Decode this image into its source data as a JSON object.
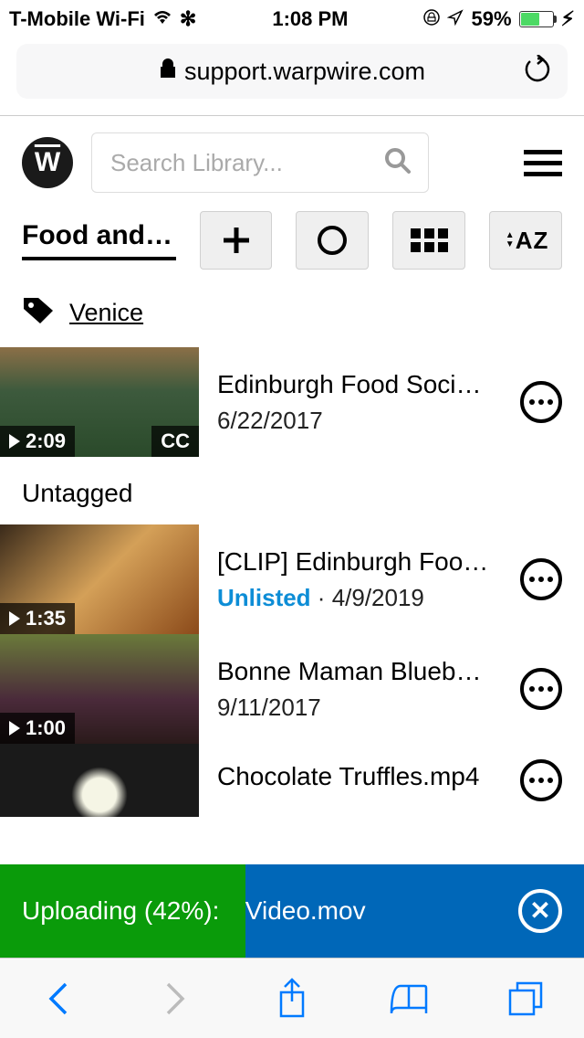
{
  "statusBar": {
    "carrier": "T-Mobile Wi-Fi",
    "time": "1:08 PM",
    "battery": "59%"
  },
  "browser": {
    "url": "support.warpwire.com"
  },
  "header": {
    "logo": "W",
    "searchPlaceholder": "Search Library..."
  },
  "category": {
    "title": "Food and …"
  },
  "tag": {
    "label": "Venice"
  },
  "sections": {
    "untagged": "Untagged"
  },
  "videos": [
    {
      "title": "Edinburgh Food Soci…",
      "date": "6/22/2017",
      "duration": "2:09",
      "cc": "CC"
    },
    {
      "title": "[CLIP] Edinburgh Foo…",
      "status": "Unlisted",
      "date": "4/9/2019",
      "duration": "1:35"
    },
    {
      "title": "Bonne Maman Blueb…",
      "date": "9/11/2017",
      "duration": "1:00"
    },
    {
      "title": "Chocolate Truffles.mp4",
      "date": ""
    }
  ],
  "upload": {
    "textLeft": "Uploading (42%): ",
    "textRight": "Video.mov",
    "percent": 42
  }
}
